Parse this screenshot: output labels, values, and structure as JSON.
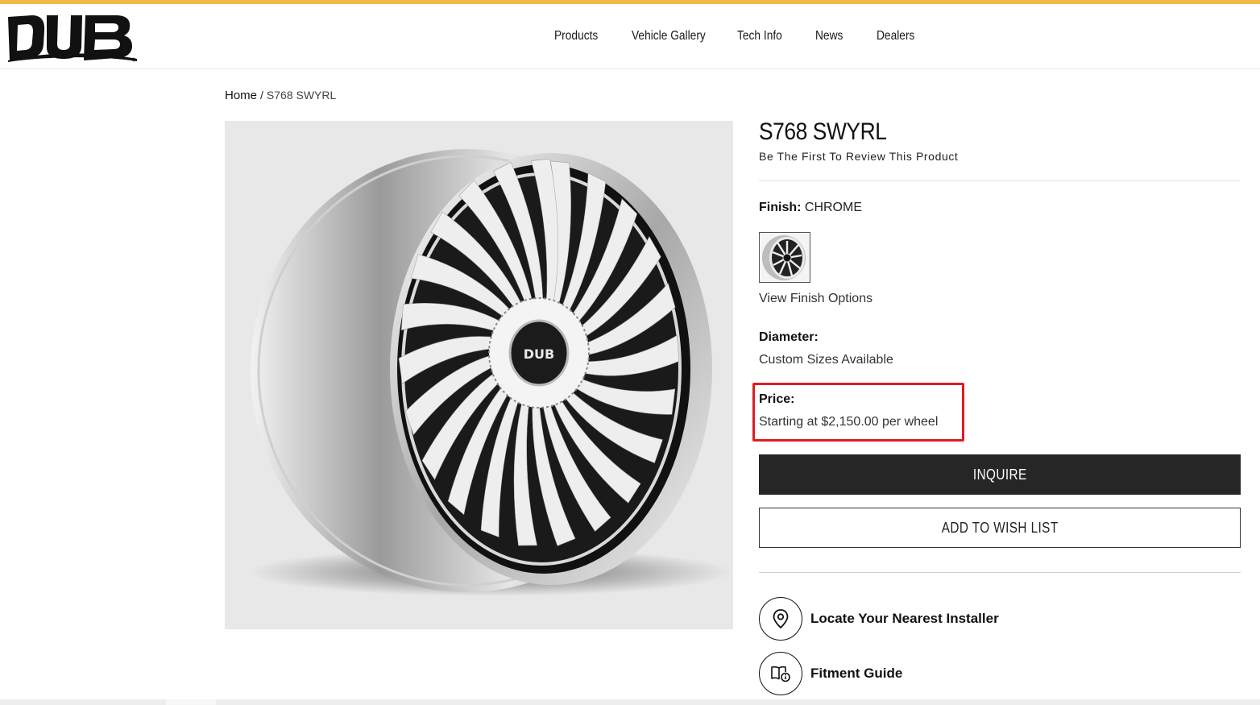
{
  "brand": {
    "logo_text": "DUB",
    "accent_color": "#f2b94a"
  },
  "nav": {
    "items": [
      {
        "label": "Products"
      },
      {
        "label": "Vehicle Gallery"
      },
      {
        "label": "Tech Info"
      },
      {
        "label": "News"
      },
      {
        "label": "Dealers"
      }
    ]
  },
  "breadcrumb": {
    "home": "Home",
    "separator": "/",
    "current": "S768 SWYRL"
  },
  "product": {
    "title": "S768 SWYRL",
    "review_link": "Be The First To Review This Product",
    "finish_label": "Finish:",
    "finish_value": "CHROME",
    "view_finish_options": "View Finish Options",
    "diameter_label": "Diameter:",
    "diameter_value": "Custom Sizes Available",
    "price_label": "Price:",
    "price_value": "Starting at $2,150.00 per wheel",
    "highlight_color": "#e01b24"
  },
  "actions": {
    "inquire": "INQUIRE",
    "wish_list": "ADD TO WISH LIST"
  },
  "links": {
    "installer": {
      "label": "Locate Your Nearest Installer",
      "icon": "map-pin-icon"
    },
    "fitment": {
      "label": "Fitment Guide",
      "icon": "book-info-icon"
    }
  }
}
